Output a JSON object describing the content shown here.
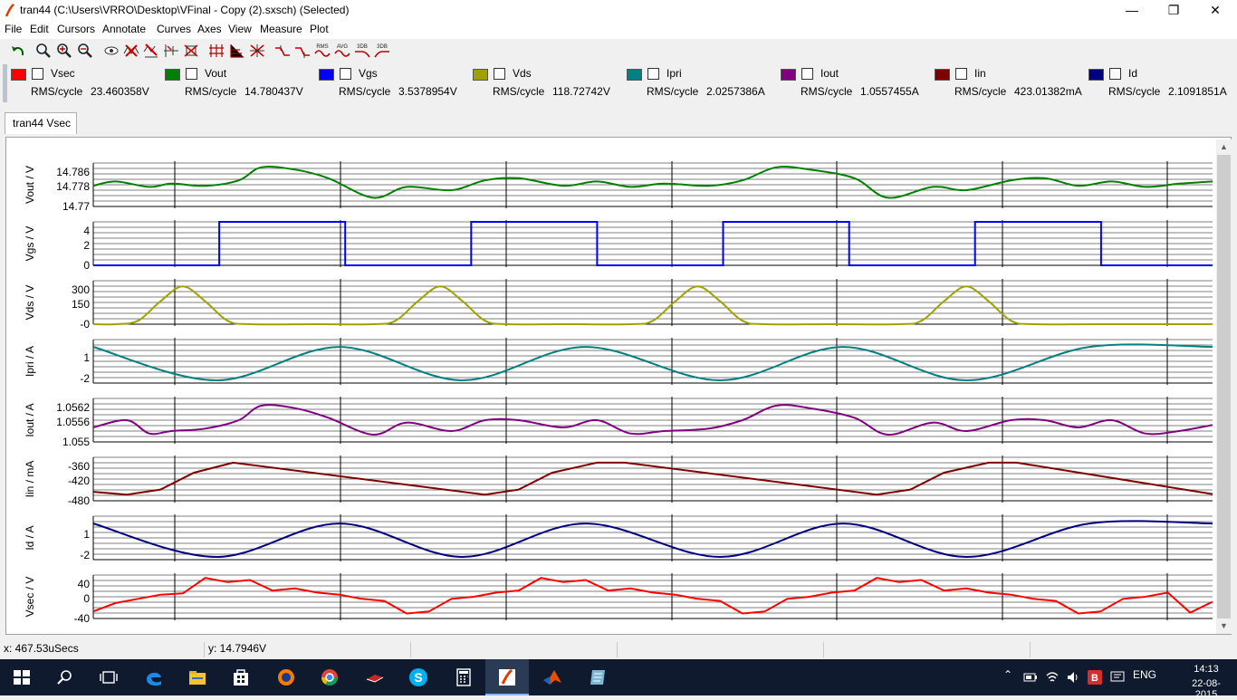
{
  "window": {
    "title": "tran44 (C:\\Users\\VRRO\\Desktop\\VFinal - Copy (2).sxsch) (Selected)",
    "minimize": "—",
    "maximize": "❐",
    "close": "✕"
  },
  "menu": [
    "File",
    "Edit",
    "Cursors",
    "Annotate",
    "Curves",
    "Axes",
    "View",
    "Measure",
    "Plot"
  ],
  "toolbar": {
    "icons": [
      "undo-icon",
      "zoom-fit-icon",
      "zoom-in-icon",
      "zoom-out-icon",
      "eye-icon",
      "delete-curve-icon",
      "add-curve-icon",
      "scale-icon",
      "axes-icon",
      "grid-icon",
      "split-axes-icon",
      "cursor-icon",
      "cursor-alt-icon"
    ],
    "measure_labels": [
      "RMS",
      "AVG",
      "3DB",
      "3DB"
    ]
  },
  "legend": [
    {
      "name": "Vsec",
      "color": "#ff0000",
      "measure": "RMS/cycle",
      "value": "23.460358V"
    },
    {
      "name": "Vout",
      "color": "#008000",
      "measure": "RMS/cycle",
      "value": "14.780437V"
    },
    {
      "name": "Vgs",
      "color": "#0000ff",
      "measure": "RMS/cycle",
      "value": "3.5378954V"
    },
    {
      "name": "Vds",
      "color": "#a0a000",
      "measure": "RMS/cycle",
      "value": "118.72742V"
    },
    {
      "name": "Ipri",
      "color": "#008080",
      "measure": "RMS/cycle",
      "value": "2.0257386A"
    },
    {
      "name": "Iout",
      "color": "#800080",
      "measure": "RMS/cycle",
      "value": "1.0557455A"
    },
    {
      "name": "Iin",
      "color": "#800000",
      "measure": "RMS/cycle",
      "value": "423.01382mA"
    },
    {
      "name": "Id",
      "color": "#000080",
      "measure": "RMS/cycle",
      "value": "2.1091851A"
    }
  ],
  "tab": {
    "label": "tran44 Vsec"
  },
  "status": {
    "x": "x: 467.53uSecs",
    "y": "y: 14.7946V"
  },
  "taskbar": {
    "icons": [
      "windows-start-icon",
      "search-icon",
      "task-view-icon",
      "edge-icon",
      "file-explorer-icon",
      "store-icon",
      "firefox-icon",
      "chrome-icon",
      "book-icon",
      "skype-icon",
      "calculator-icon",
      "simetrix-icon",
      "matlab-icon",
      "notes-icon"
    ],
    "tray_lang": "ENG",
    "time": "14:13",
    "date": "22-08-2015"
  },
  "chart_data": [
    {
      "type": "line",
      "title": "",
      "ylabel": "Vout / V",
      "ylim": [
        14.77,
        14.79
      ],
      "yticks": [
        "14.786",
        "14.778",
        "14.77"
      ],
      "series": [
        {
          "color": "#008000",
          "x": [
            0,
            0.02,
            0.05,
            0.07,
            0.1,
            0.13,
            0.15,
            0.18,
            0.21,
            0.25,
            0.28,
            0.32,
            0.35,
            0.38,
            0.42,
            0.45,
            0.48,
            0.51,
            0.55,
            0.58,
            0.61,
            0.64,
            0.68,
            0.71,
            0.75,
            0.78,
            0.82,
            0.85,
            0.88,
            0.91,
            0.94,
            0.97,
            1
          ],
          "values": [
            14.7795,
            14.7815,
            14.779,
            14.7805,
            14.7795,
            14.782,
            14.788,
            14.787,
            14.783,
            14.774,
            14.779,
            14.7775,
            14.782,
            14.783,
            14.7795,
            14.7815,
            14.779,
            14.7805,
            14.7795,
            14.782,
            14.788,
            14.787,
            14.783,
            14.774,
            14.779,
            14.7775,
            14.782,
            14.783,
            14.7795,
            14.7815,
            14.779,
            14.7805,
            14.7815
          ]
        }
      ]
    },
    {
      "type": "line",
      "title": "",
      "ylabel": "Vgs / V",
      "ylim": [
        0,
        6
      ],
      "yticks": [
        "4",
        "2",
        "0"
      ],
      "series": [
        {
          "color": "#0000ff",
          "x": [
            0,
            0.1125,
            0.1125,
            0.2251,
            0.2251,
            0.3376,
            0.3376,
            0.4502,
            0.4502,
            0.5627,
            0.5627,
            0.6753,
            0.6753,
            0.7878,
            0.7878,
            0.9004,
            0.9004,
            1
          ],
          "values": [
            0,
            0,
            6,
            6,
            0,
            0,
            6,
            6,
            0,
            0,
            6,
            6,
            0,
            0,
            6,
            6,
            0,
            0
          ]
        }
      ]
    },
    {
      "type": "line",
      "title": "",
      "ylabel": "Vds / V",
      "ylim": [
        0,
        380
      ],
      "yticks": [
        "300",
        "150",
        "-0"
      ],
      "series": [
        {
          "color": "#a0a000",
          "x": [
            0,
            0.02,
            0.04,
            0.06,
            0.08,
            0.1,
            0.12,
            0.14,
            0.2,
            0.25,
            0.27,
            0.29,
            0.31,
            0.33,
            0.35,
            0.37,
            0.42,
            0.48,
            0.5,
            0.52,
            0.54,
            0.56,
            0.58,
            0.6,
            0.66,
            0.72,
            0.74,
            0.76,
            0.78,
            0.8,
            0.82,
            0.84,
            0.9,
            1
          ],
          "values": [
            0,
            0,
            30,
            200,
            330,
            200,
            30,
            0,
            0,
            0,
            30,
            200,
            330,
            200,
            30,
            0,
            0,
            0,
            30,
            200,
            330,
            200,
            30,
            0,
            0,
            0,
            30,
            200,
            330,
            200,
            30,
            0,
            0,
            0
          ]
        }
      ]
    },
    {
      "type": "line",
      "title": "",
      "ylabel": "Ipri / A",
      "ylim": [
        -3,
        3.5
      ],
      "yticks": [
        "1",
        "-2"
      ],
      "series": [
        {
          "color": "#008080",
          "x": [
            0,
            0.11,
            0.22,
            0.33,
            0.44,
            0.56,
            0.67,
            0.78,
            0.89,
            1
          ],
          "values": [
            2.4,
            -2.6,
            2.4,
            -2.6,
            2.4,
            -2.6,
            2.4,
            -2.6,
            2.4,
            2.4
          ]
        }
      ]
    },
    {
      "type": "line",
      "title": "",
      "ylabel": "Iout / A",
      "ylim": [
        1.055,
        1.0568
      ],
      "yticks": [
        "1.0562",
        "1.0556",
        "1.055"
      ],
      "series": [
        {
          "color": "#800080",
          "x": [
            0,
            0.03,
            0.05,
            0.07,
            0.1,
            0.13,
            0.15,
            0.18,
            0.21,
            0.25,
            0.28,
            0.32,
            0.35,
            0.38,
            0.42,
            0.45,
            0.48,
            0.51,
            0.55,
            0.58,
            0.61,
            0.64,
            0.68,
            0.71,
            0.75,
            0.78,
            0.82,
            0.85,
            0.88,
            0.91,
            0.94,
            0.97,
            1
          ],
          "values": [
            1.0556,
            1.0559,
            1.05535,
            1.05545,
            1.05555,
            1.0559,
            1.0565,
            1.0564,
            1.056,
            1.0553,
            1.0558,
            1.05545,
            1.0559,
            1.0559,
            1.0556,
            1.0559,
            1.05535,
            1.05545,
            1.05555,
            1.0559,
            1.0565,
            1.0564,
            1.056,
            1.0553,
            1.0558,
            1.05545,
            1.0559,
            1.0559,
            1.0556,
            1.0559,
            1.05535,
            1.05545,
            1.0557
          ]
        }
      ]
    },
    {
      "type": "line",
      "title": "",
      "ylabel": "Iin / mA",
      "ylim": [
        -500,
        -345
      ],
      "yticks": [
        "-360",
        "-420",
        "-480"
      ],
      "series": [
        {
          "color": "#800000",
          "x": [
            0,
            0.03,
            0.06,
            0.09,
            0.125,
            0.35,
            0.38,
            0.41,
            0.45,
            0.475,
            0.7,
            0.73,
            0.76,
            0.8,
            0.825,
            1
          ],
          "values": [
            -468,
            -478,
            -460,
            -400,
            -364,
            -478,
            -460,
            -400,
            -364,
            -364,
            -478,
            -460,
            -400,
            -364,
            -364,
            -476
          ]
        }
      ]
    },
    {
      "type": "line",
      "title": "",
      "ylabel": "Id / A",
      "ylim": [
        -3,
        3.5
      ],
      "yticks": [
        "1",
        "-2"
      ],
      "series": [
        {
          "color": "#000080",
          "x": [
            0,
            0.11,
            0.22,
            0.33,
            0.44,
            0.56,
            0.67,
            0.78,
            0.89,
            1
          ],
          "values": [
            2.4,
            -2.6,
            2.4,
            -2.6,
            2.4,
            -2.6,
            2.4,
            -2.6,
            2.4,
            2.4
          ]
        }
      ]
    },
    {
      "type": "line",
      "title": "",
      "ylabel": "Vsec / V",
      "ylim": [
        -52,
        52
      ],
      "yticks": [
        "40",
        "0",
        "-40"
      ],
      "series": [
        {
          "color": "#ff0000",
          "x": [
            0,
            0.02,
            0.04,
            0.06,
            0.08,
            0.1,
            0.12,
            0.14,
            0.16,
            0.18,
            0.2,
            0.22,
            0.24,
            0.26,
            0.28,
            0.3,
            0.32,
            0.34,
            0.36,
            0.38,
            0.4,
            0.42,
            0.44,
            0.46,
            0.48,
            0.5,
            0.52,
            0.54,
            0.56,
            0.58,
            0.6,
            0.62,
            0.64,
            0.66,
            0.68,
            0.7,
            0.72,
            0.74,
            0.76,
            0.78,
            0.8,
            0.82,
            0.84,
            0.86,
            0.88,
            0.9,
            0.92,
            0.94,
            0.96,
            0.98,
            1
          ],
          "values": [
            -35,
            -15,
            -5,
            5,
            8,
            45,
            35,
            40,
            15,
            20,
            10,
            5,
            -5,
            -10,
            -40,
            -35,
            -5,
            0,
            10,
            15,
            45,
            35,
            40,
            15,
            20,
            10,
            5,
            -5,
            -10,
            -40,
            -35,
            -5,
            0,
            10,
            15,
            45,
            35,
            40,
            15,
            20,
            10,
            5,
            -5,
            -10,
            -40,
            -35,
            -5,
            0,
            10,
            -38,
            -12
          ]
        }
      ]
    }
  ]
}
